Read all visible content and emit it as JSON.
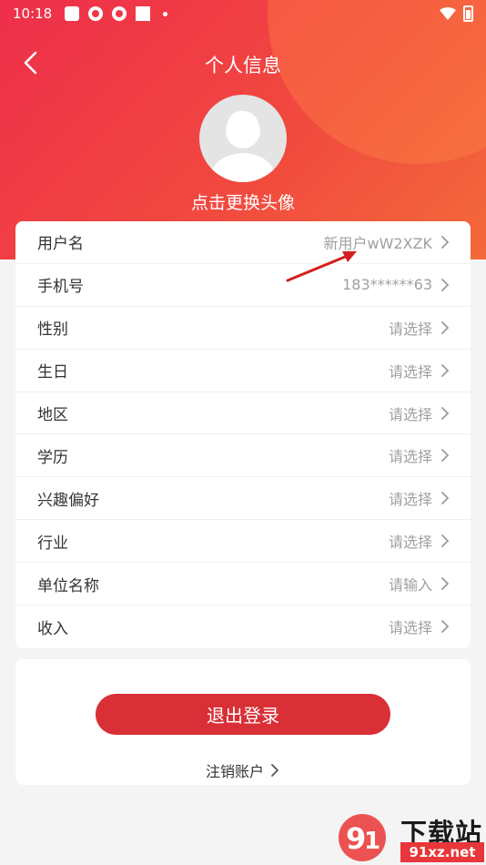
{
  "status_bar": {
    "time": "10:18"
  },
  "header": {
    "title": "个人信息"
  },
  "avatar": {
    "caption": "点击更换头像"
  },
  "profile_rows": [
    {
      "label": "用户名",
      "value": "新用户wW2XZK"
    },
    {
      "label": "手机号",
      "value": "183******63"
    },
    {
      "label": "性别",
      "value": "请选择"
    },
    {
      "label": "生日",
      "value": "请选择"
    },
    {
      "label": "地区",
      "value": "请选择"
    },
    {
      "label": "学历",
      "value": "请选择"
    },
    {
      "label": "兴趣偏好",
      "value": "请选择"
    },
    {
      "label": "行业",
      "value": "请选择"
    },
    {
      "label": "单位名称",
      "value": "请输入"
    },
    {
      "label": "收入",
      "value": "请选择"
    }
  ],
  "actions": {
    "logout_label": "退出登录",
    "cancel_account_label": "注销账户"
  },
  "watermark": {
    "brand": "下载站",
    "url": "91xz.net"
  },
  "colors": {
    "header_red": "#ee2f4b",
    "button_red": "#d92f36",
    "value_gray": "#a0a0a0"
  }
}
